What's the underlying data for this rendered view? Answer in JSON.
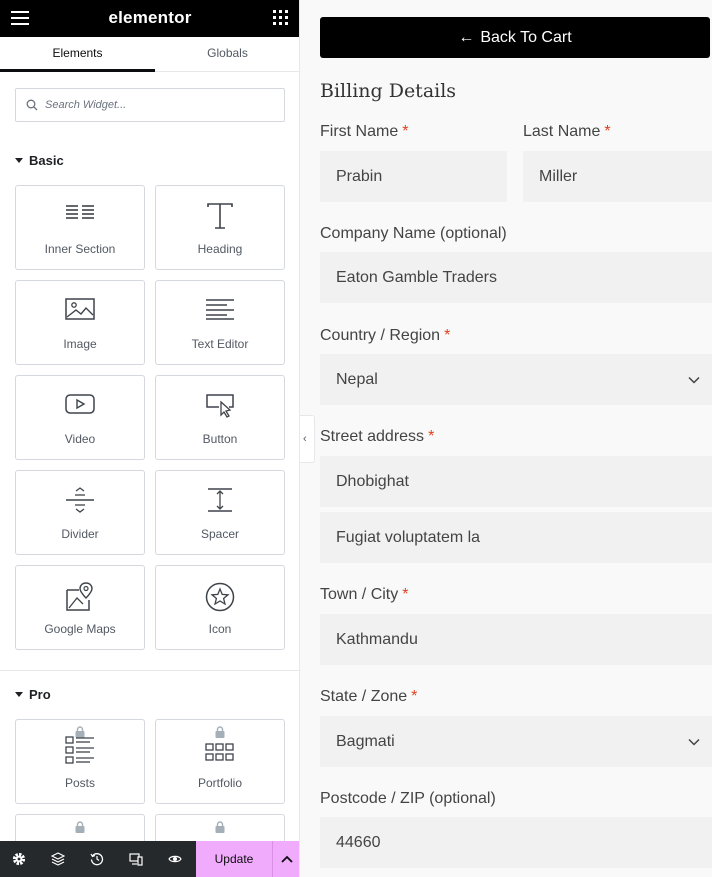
{
  "editor": {
    "brand": "elementor",
    "tabs": [
      "Elements",
      "Globals"
    ],
    "search_placeholder": "Search Widget...",
    "sections": {
      "basic": "Basic",
      "pro": "Pro"
    },
    "basic_widgets": [
      "Inner Section",
      "Heading",
      "Image",
      "Text Editor",
      "Video",
      "Button",
      "Divider",
      "Spacer",
      "Google Maps",
      "Icon"
    ],
    "pro_widgets": [
      "Posts",
      "Portfolio"
    ],
    "update_label": "Update",
    "accent_color": "#f0abfc"
  },
  "checkout": {
    "back_label": "Back To Cart",
    "billing_title": "Billing Details",
    "required_mark": "*",
    "first_name": {
      "label": "First Name",
      "value": "Prabin"
    },
    "last_name": {
      "label": "Last Name",
      "value": "Miller"
    },
    "company": {
      "label": "Company Name (optional)",
      "value": "Eaton Gamble Traders"
    },
    "country": {
      "label": "Country / Region",
      "value": "Nepal"
    },
    "street": {
      "label": "Street address",
      "value1": "Dhobighat",
      "value2": "Fugiat voluptatem la"
    },
    "city": {
      "label": "Town / City",
      "value": "Kathmandu"
    },
    "state": {
      "label": "State / Zone",
      "value": "Bagmati"
    },
    "postcode": {
      "label": "Postcode / ZIP (optional)",
      "value": "44660"
    },
    "required_color": "#e2401c"
  }
}
